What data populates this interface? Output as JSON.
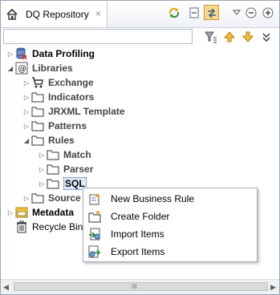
{
  "view": {
    "tab_title": "DQ Repository",
    "tab_close": "×",
    "filter": {
      "value": "",
      "placeholder": ""
    }
  },
  "tree": [
    {
      "label": "Data Profiling",
      "expanded": false,
      "icon": "database-profiling-icon"
    },
    {
      "label": "Libraries",
      "expanded": true,
      "icon": "libraries-icon"
    },
    {
      "label": "Exchange",
      "icon": "cart-icon"
    },
    {
      "label": "Indicators",
      "icon": "folder-icon"
    },
    {
      "label": "JRXML Template",
      "icon": "folder-icon"
    },
    {
      "label": "Patterns",
      "icon": "folder-icon"
    },
    {
      "label": "Rules",
      "expanded": true,
      "icon": "folder-icon"
    },
    {
      "label": "Match",
      "icon": "folder-icon"
    },
    {
      "label": "Parser",
      "icon": "folder-icon"
    },
    {
      "label": "SQL",
      "selected": true,
      "icon": "folder-icon"
    },
    {
      "label": "Source",
      "icon": "folder-icon"
    },
    {
      "label": "Metadata",
      "icon": "metadata-icon"
    },
    {
      "label": "Recycle Bin",
      "icon": "trash-icon"
    }
  ],
  "context_menu": [
    {
      "label": "New Business Rule",
      "icon": "new-business-rule-icon"
    },
    {
      "label": "Create Folder",
      "icon": "create-folder-icon"
    },
    {
      "label": "Import Items",
      "icon": "import-items-icon"
    },
    {
      "label": "Export Items",
      "icon": "export-items-icon"
    }
  ],
  "scrollbar": {
    "grip": "III"
  },
  "colors": {
    "selection": "#dfe9f7",
    "frame": "#9aa7b8",
    "accent_orange": "#f2a11d"
  }
}
